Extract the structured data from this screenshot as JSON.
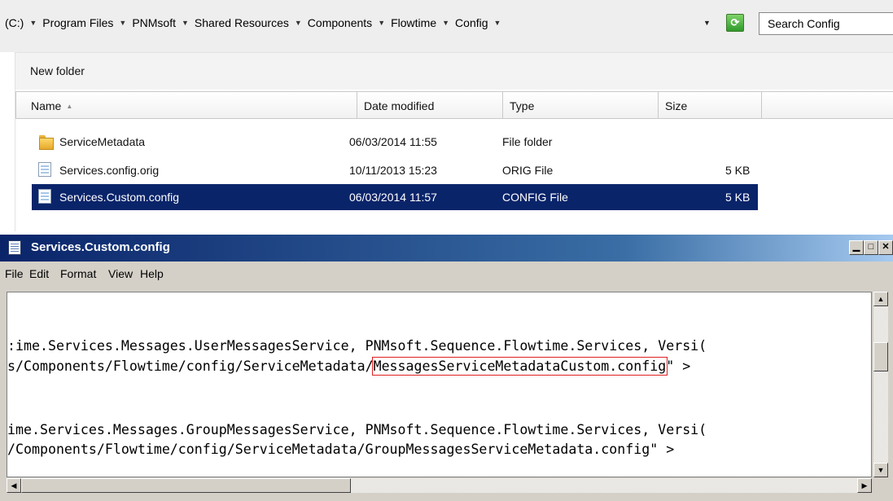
{
  "explorer": {
    "breadcrumb": [
      "(C:)",
      "Program Files",
      "PNMsoft",
      "Shared Resources",
      "Components",
      "Flowtime",
      "Config"
    ],
    "search_placeholder": "Search Config",
    "toolbar": {
      "new_folder_label": "New folder"
    },
    "columns": {
      "name": "Name",
      "date": "Date modified",
      "type": "Type",
      "size": "Size"
    },
    "files": [
      {
        "name": "ServiceMetadata",
        "date": "06/03/2014 11:55",
        "type": "File folder",
        "size": "",
        "icon": "folder-icon",
        "selected": false
      },
      {
        "name": "Services.config.orig",
        "date": "10/11/2013 15:23",
        "type": "ORIG File",
        "size": "5 KB",
        "icon": "document-icon",
        "selected": false
      },
      {
        "name": "Services.Custom.config",
        "date": "06/03/2014 11:57",
        "type": "CONFIG File",
        "size": "5 KB",
        "icon": "document-icon",
        "selected": true
      }
    ]
  },
  "notepad": {
    "title": "Services.Custom.config",
    "menu": [
      "File",
      "Edit",
      "Format",
      "View",
      "Help"
    ],
    "lines": {
      "l1": ":ime.Services.Messages.UserMessagesService, PNMsoft.Sequence.Flowtime.Services, Versi(",
      "l2_pre": "s/Components/Flowtime/config/ServiceMetadata/",
      "l2_highlight": "MessagesServiceMetadataCustom.config",
      "l2_post": "\" >",
      "l3": "ime.Services.Messages.GroupMessagesService, PNMsoft.Sequence.Flowtime.Services, Versi(",
      "l4": "/Components/Flowtime/config/ServiceMetadata/GroupMessagesServiceMetadata.config\" >"
    },
    "colors": {
      "title_bar": "#0a246a",
      "selection": "#0a246a",
      "highlight_box": "#e02020"
    }
  }
}
